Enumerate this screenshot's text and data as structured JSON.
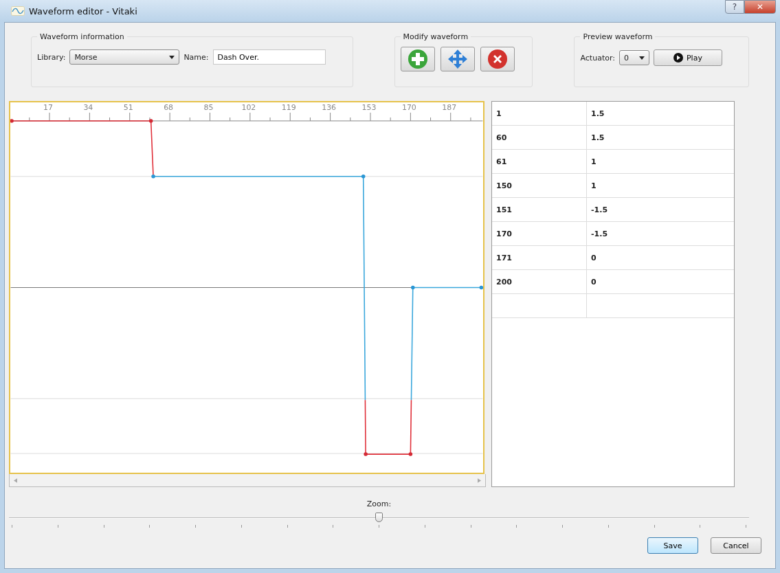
{
  "window": {
    "title": "Waveform editor - Vitaki",
    "help_button": "?",
    "close_button": "✕"
  },
  "waveform_information": {
    "title": "Waveform information",
    "library_label": "Library:",
    "library": "Morse",
    "name_label": "Name:",
    "name": "Dash Over."
  },
  "modify_waveform": {
    "title": "Modify waveform"
  },
  "preview_waveform": {
    "title": "Preview waveform",
    "actuator_label": "Actuator:",
    "actuator": "0",
    "play_button": "Play"
  },
  "plot": {
    "ruler_labels": [
      "17",
      "34",
      "51",
      "68",
      "85",
      "102",
      "119",
      "136",
      "153",
      "170",
      "187"
    ]
  },
  "table": {
    "rows": [
      {
        "time": "1",
        "value": "1.5"
      },
      {
        "time": "60",
        "value": "1.5"
      },
      {
        "time": "61",
        "value": "1"
      },
      {
        "time": "150",
        "value": "1"
      },
      {
        "time": "151",
        "value": "-1.5"
      },
      {
        "time": "170",
        "value": "-1.5"
      },
      {
        "time": "171",
        "value": "0"
      },
      {
        "time": "200",
        "value": "0"
      }
    ]
  },
  "zoom": {
    "label": "Zoom:",
    "level": 0.5
  },
  "buttons": {
    "save": "Save",
    "cancel": "Cancel"
  }
}
